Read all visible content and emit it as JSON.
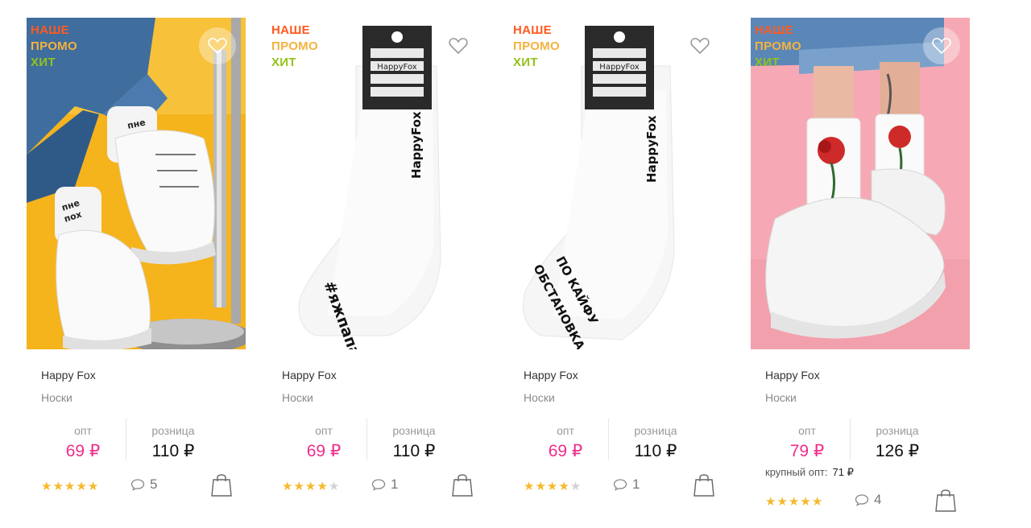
{
  "badges": {
    "new": "НАШЕ",
    "promo": "ПРОМО",
    "hit": "ХИТ"
  },
  "price_labels": {
    "opt": "опт",
    "retail": "розница"
  },
  "colors": {
    "opt_price": "#ef2e8a",
    "badge_new": "#ff5a1f",
    "badge_promo": "#f4b23e",
    "badge_hit": "#93c21a",
    "star": "#f6b92b"
  },
  "products": [
    {
      "brand": "Happy Fox",
      "category": "Носки",
      "opt_price": "69 ₽",
      "retail_price": "110 ₽",
      "rating": 5,
      "reviews": "5",
      "image_text": [
        "пне",
        "пох"
      ]
    },
    {
      "brand": "Happy Fox",
      "category": "Носки",
      "opt_price": "69 ₽",
      "retail_price": "110 ₽",
      "rating": 4,
      "reviews": "1",
      "image_text": [
        "HappyFox",
        "#яжпапа"
      ]
    },
    {
      "brand": "Happy Fox",
      "category": "Носки",
      "opt_price": "69 ₽",
      "retail_price": "110 ₽",
      "rating": 4,
      "reviews": "1",
      "image_text": [
        "HappyFox",
        "ОБСТАНОВКА",
        "ПО КАЙФУ"
      ]
    },
    {
      "brand": "Happy Fox",
      "category": "Носки",
      "opt_price": "79 ₽",
      "retail_price": "126 ₽",
      "rating": 5,
      "reviews": "4",
      "bulk_label": "крупный опт:",
      "bulk_price": "71 ₽"
    }
  ]
}
